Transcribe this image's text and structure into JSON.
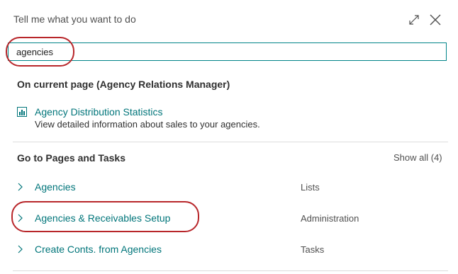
{
  "dialog": {
    "title": "Tell me what you want to do",
    "expand_icon": "expand-diagonal-icon",
    "close_icon": "close-x-icon"
  },
  "search": {
    "value": "agencies"
  },
  "current_page": {
    "heading": "On current page (Agency Relations Manager)",
    "results": [
      {
        "label": "Agency Distribution Statistics",
        "description": "View detailed information about sales to your agencies.",
        "icon": "report-icon"
      }
    ]
  },
  "pages_tasks": {
    "heading": "Go to Pages and Tasks",
    "show_all": "Show all (4)",
    "results": [
      {
        "label": "Agencies",
        "category": "Lists"
      },
      {
        "label": "Agencies & Receivables Setup",
        "category": "Administration"
      },
      {
        "label": "Create Conts. from Agencies",
        "category": "Tasks"
      }
    ]
  },
  "colors": {
    "accent": "#00757a",
    "annotation": "#b8262a",
    "divider": "#dcdcdc"
  }
}
